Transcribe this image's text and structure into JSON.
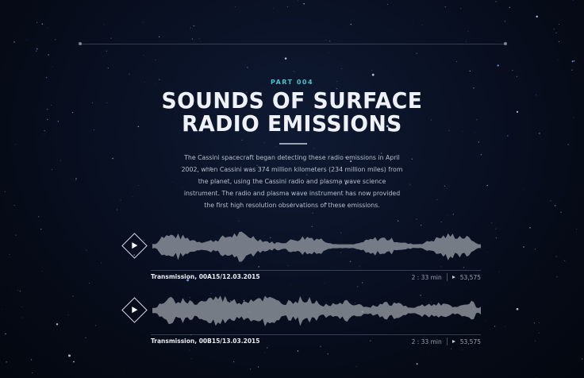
{
  "header": {
    "part_label": "PART 004",
    "title_line1": "SOUNDS OF SURFACE",
    "title_line2": "RADIO EMISSIONS",
    "description": "The Cassini spacecraft began detecting these radio emissions in April 2002, when Cassini was 374 million kilometers (234 million miles) from the planet, using the Cassini radio and plasma wave science instrument. The radio and plasma wave instrument has now provided the first high resolution observations of these emissions."
  },
  "tracks": [
    {
      "name": "Transmission, 00A15/12.03.2015",
      "duration": "2 : 33 min",
      "plays": "53,575",
      "play_icon": "play-icon",
      "plays_icon": "play-count-icon"
    },
    {
      "name": "Transmission, 00B15/13.03.2015",
      "duration": "2 : 33 min",
      "plays": "53,575",
      "play_icon": "play-icon",
      "plays_icon": "play-count-icon"
    }
  ],
  "colors": {
    "accent": "#48c1c9",
    "title": "#eef1f6",
    "waveform": "#8a8f99",
    "background": "#0a1226"
  }
}
